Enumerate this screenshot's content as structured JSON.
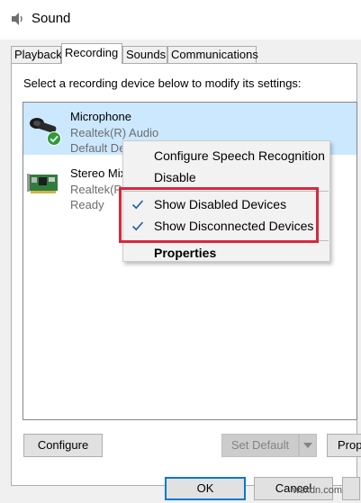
{
  "window": {
    "title": "Sound",
    "icon": "speaker-icon"
  },
  "tabs": [
    {
      "label": "Playback",
      "active": false
    },
    {
      "label": "Recording",
      "active": true
    },
    {
      "label": "Sounds",
      "active": false
    },
    {
      "label": "Communications",
      "active": false
    }
  ],
  "instructions": "Select a recording device below to modify its settings:",
  "devices": [
    {
      "name": "Microphone",
      "driver": "Realtek(R) Audio",
      "status": "Default Dev",
      "icon": "microphone-icon",
      "badge": "default-check-badge",
      "selected": true
    },
    {
      "name": "Stereo Mix",
      "driver": "Realtek(R)",
      "status": "Ready",
      "icon": "sound-card-icon",
      "selected": false
    }
  ],
  "context_menu": {
    "items": [
      {
        "label": "Configure Speech Recognition",
        "checked": false
      },
      {
        "label": "Disable",
        "checked": false
      },
      {
        "label": "Show Disabled Devices",
        "checked": true
      },
      {
        "label": "Show Disconnected Devices",
        "checked": true
      },
      {
        "label": "Properties",
        "bold": true
      }
    ]
  },
  "buttons": {
    "configure": "Configure",
    "set_default": "Set Default",
    "properties": "Prop",
    "ok": "OK",
    "cancel": "Cancel"
  },
  "watermark": "wsxdn.com",
  "colors": {
    "selection": "#cce8ff",
    "highlight_box": "#d9283a",
    "check": "#1f5fa6",
    "default_badge": "#2e9b3a"
  }
}
